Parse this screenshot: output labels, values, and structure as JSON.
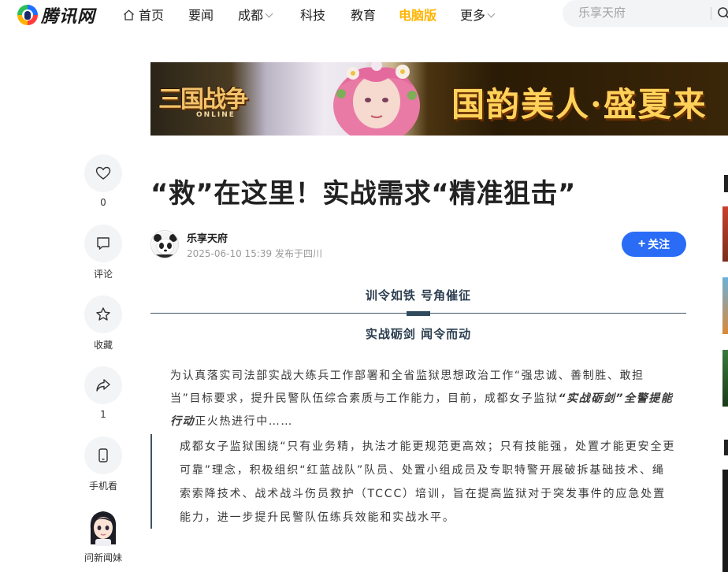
{
  "nav": {
    "logo_text": "腾讯网",
    "items": [
      "首页",
      "要闻",
      "成都",
      "科技",
      "教育",
      "电脑版",
      "更多"
    ],
    "search_placeholder": "乐享天府"
  },
  "banner": {
    "game_logo": "三国战争",
    "game_sub": "ONLINE",
    "slogan": "国韵美人·盛夏来"
  },
  "sidebar": {
    "like_count": "0",
    "comment_label": "评论",
    "collect_label": "收藏",
    "share_count": "1",
    "mobile_label": "手机看",
    "assistant_label": "问新闻妹"
  },
  "article": {
    "title": "“救”在这里！实战需求“精准狙击”",
    "author": "乐享天府",
    "meta": "2025-06-10 15:39 发布于四川",
    "follow_label": "关注",
    "heading1": "训令如铁  号角催征",
    "heading2": "实战砺剑  闻令而动",
    "para1_a": "为认真落实司法部实战大练兵工作部署和全省监狱思想政治工作“强忠诚、善制胜、敢担当”目标要求，提升民警队伍综合素质与工作能力，目前，成都女子监狱",
    "para1_em": "“实战砺剑”全警提能行动",
    "para1_b": "正火热进行中……",
    "para2": "成都女子监狱围绕“只有业务精，执法才能更规范更高效；只有技能强，处置才能更安全更可靠”理念，积极组织“红蓝战队”队员、处置小组成员及专职特警开展破拆基础技术、绳索索降技术、战术战斗伤员救护（TCCC）培训，旨在提高监狱对于突发事件的应急处置能力，进一步提升民警队伍练兵效能和实战水平。"
  }
}
